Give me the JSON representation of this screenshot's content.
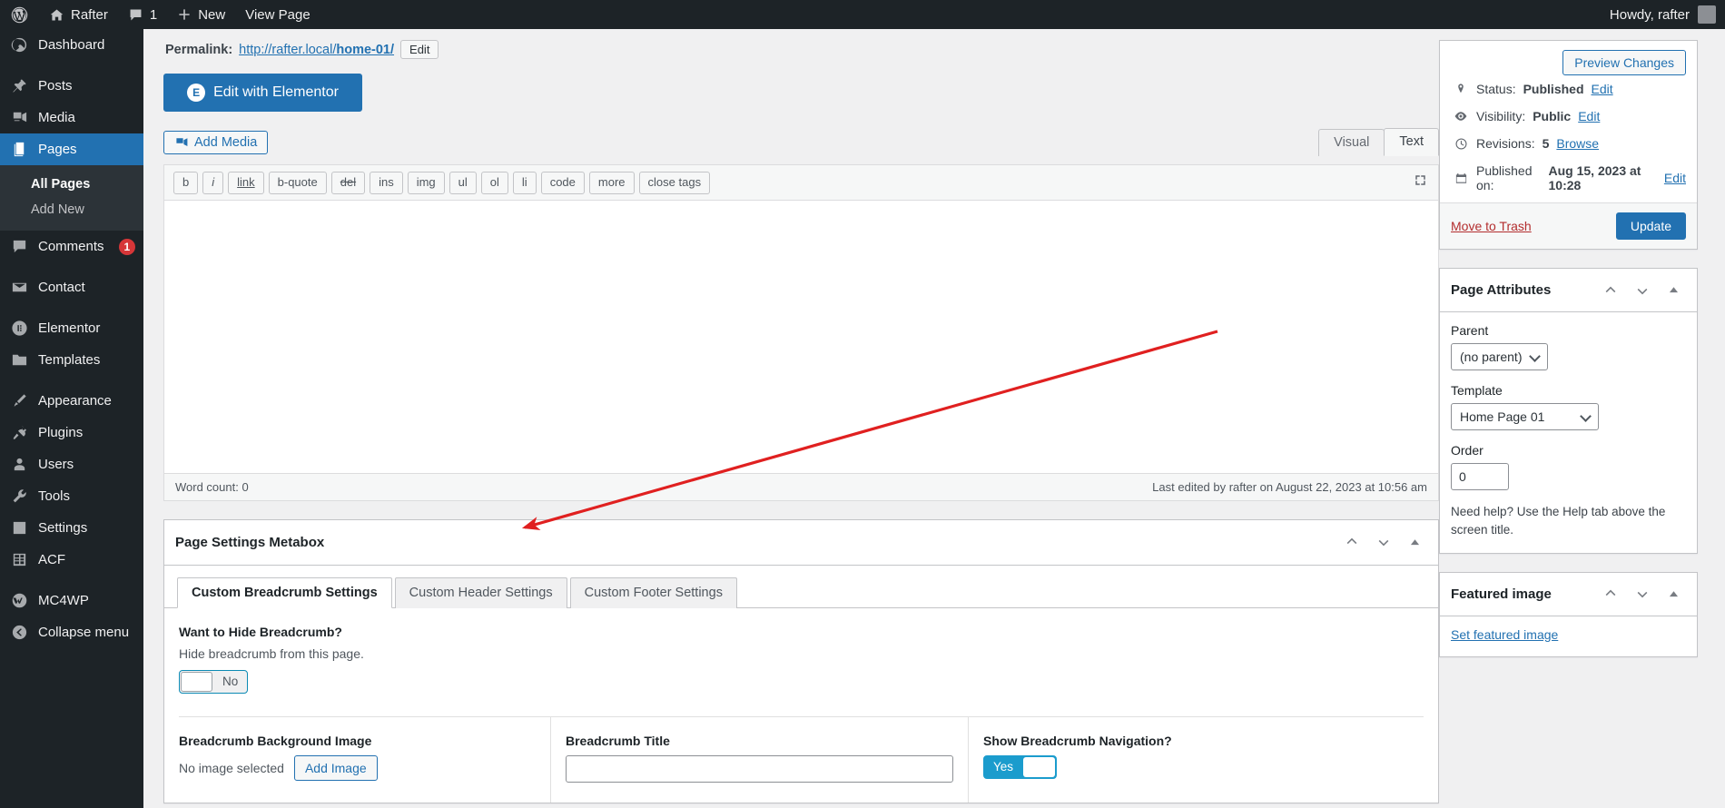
{
  "adminbar": {
    "logo_icon": "wordpress-logo-icon",
    "site_name": "Rafter",
    "comments_count": "1",
    "new_label": "New",
    "view_page_label": "View Page",
    "howdy": "Howdy, rafter"
  },
  "sidebar": {
    "items": [
      {
        "label": "Dashboard",
        "icon": "dashboard-icon",
        "active": false
      },
      {
        "label": "Posts",
        "icon": "pin-icon",
        "active": false
      },
      {
        "label": "Media",
        "icon": "media-icon",
        "active": false
      },
      {
        "label": "Pages",
        "icon": "pages-icon",
        "active": true
      },
      {
        "label": "Comments",
        "icon": "comments-icon",
        "active": false,
        "badge": "1"
      },
      {
        "label": "Contact",
        "icon": "mail-icon",
        "active": false
      },
      {
        "label": "Elementor",
        "icon": "elementor-icon",
        "active": false
      },
      {
        "label": "Templates",
        "icon": "folder-icon",
        "active": false
      },
      {
        "label": "Appearance",
        "icon": "brush-icon",
        "active": false
      },
      {
        "label": "Plugins",
        "icon": "plugin-icon",
        "active": false
      },
      {
        "label": "Users",
        "icon": "user-icon",
        "active": false
      },
      {
        "label": "Tools",
        "icon": "wrench-icon",
        "active": false
      },
      {
        "label": "Settings",
        "icon": "settings-icon",
        "active": false
      },
      {
        "label": "ACF",
        "icon": "acf-icon",
        "active": false
      },
      {
        "label": "MC4WP",
        "icon": "mailchimp-icon",
        "active": false
      },
      {
        "label": "Collapse menu",
        "icon": "collapse-icon",
        "active": false
      }
    ],
    "submenu": [
      {
        "label": "All Pages",
        "current": true
      },
      {
        "label": "Add New",
        "current": false
      }
    ]
  },
  "editor": {
    "permalink_label": "Permalink:",
    "permalink_prefix": "http://rafter.local/",
    "permalink_slug": "home-01/",
    "permalink_edit": "Edit",
    "elementor_button": "Edit with Elementor",
    "elementor_badge": "E",
    "add_media": "Add Media",
    "tabs": [
      {
        "label": "Visual",
        "active": false
      },
      {
        "label": "Text",
        "active": true
      }
    ],
    "quicktags": [
      "b",
      "i",
      "link",
      "b-quote",
      "del",
      "ins",
      "img",
      "ul",
      "ol",
      "li",
      "code",
      "more",
      "close tags"
    ],
    "expand_icon": "fullscreen-icon",
    "word_count": "Word count: 0",
    "last_edited": "Last edited by rafter on August 22, 2023 at 10:56 am"
  },
  "metabox": {
    "title": "Page Settings Metabox",
    "handles": [
      "move-up-icon",
      "move-down-icon",
      "toggle-panel-icon"
    ],
    "tabs": [
      {
        "label": "Custom Breadcrumb Settings",
        "active": true
      },
      {
        "label": "Custom Header Settings",
        "active": false
      },
      {
        "label": "Custom Footer Settings",
        "active": false
      }
    ],
    "hide_breadcrumb": {
      "label": "Want to Hide Breadcrumb?",
      "description": "Hide breadcrumb from this page.",
      "toggle_state": "No"
    },
    "background_image": {
      "label": "Breadcrumb Background Image",
      "status": "No image selected",
      "button": "Add Image"
    },
    "breadcrumb_title": {
      "label": "Breadcrumb Title",
      "value": "",
      "placeholder": ""
    },
    "show_navigation": {
      "label": "Show Breadcrumb Navigation?",
      "toggle_state": "Yes"
    }
  },
  "publish_panel": {
    "preview_button": "Preview Changes",
    "rows": [
      {
        "icon": "pin-status-icon",
        "label": "Status:",
        "value": "Published",
        "action": "Edit"
      },
      {
        "icon": "eye-icon",
        "label": "Visibility:",
        "value": "Public",
        "action": "Edit"
      },
      {
        "icon": "clock-icon",
        "label": "Revisions:",
        "value": "5",
        "action": "Browse"
      },
      {
        "icon": "calendar-icon",
        "label": "Published on:",
        "value": "Aug 15, 2023 at 10:28",
        "action": "Edit"
      }
    ],
    "trash_label": "Move to Trash",
    "update_label": "Update"
  },
  "page_attributes": {
    "title": "Page Attributes",
    "parent_label": "Parent",
    "parent_value": "(no parent)",
    "template_label": "Template",
    "template_value": "Home Page 01",
    "order_label": "Order",
    "order_value": "0",
    "help_text": "Need help? Use the Help tab above the screen title."
  },
  "featured_image": {
    "title": "Featured image",
    "set_link": "Set featured image"
  },
  "colors": {
    "accent": "#2271b1",
    "sidebar_bg": "#1d2327",
    "toggle_on": "#1b9ccd",
    "annotation": "#e02020",
    "badge": "#d63638"
  }
}
